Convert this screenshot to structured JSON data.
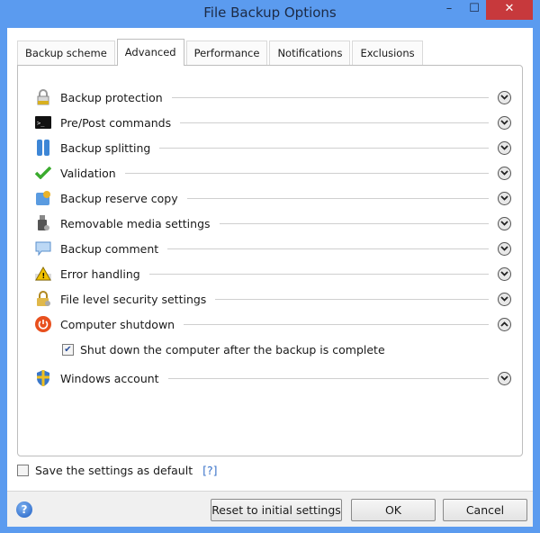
{
  "window": {
    "title": "File Backup Options",
    "minimize": "–",
    "maximize": "☐",
    "close": "✕"
  },
  "tabs": [
    {
      "label": "Backup scheme",
      "active": false
    },
    {
      "label": "Advanced",
      "active": true
    },
    {
      "label": "Performance",
      "active": false
    },
    {
      "label": "Notifications",
      "active": false
    },
    {
      "label": "Exclusions",
      "active": false
    }
  ],
  "sections": [
    {
      "label": "Backup protection",
      "icon": "lock-icon",
      "expanded": false
    },
    {
      "label": "Pre/Post commands",
      "icon": "terminal-icon",
      "expanded": false
    },
    {
      "label": "Backup splitting",
      "icon": "split-icon",
      "expanded": false
    },
    {
      "label": "Validation",
      "icon": "checkmark-icon",
      "expanded": false
    },
    {
      "label": "Backup reserve copy",
      "icon": "reserve-copy-icon",
      "expanded": false
    },
    {
      "label": "Removable media settings",
      "icon": "usb-drive-icon",
      "expanded": false
    },
    {
      "label": "Backup comment",
      "icon": "comment-icon",
      "expanded": false
    },
    {
      "label": "Error handling",
      "icon": "warning-icon",
      "expanded": false
    },
    {
      "label": "File level security settings",
      "icon": "security-lock-icon",
      "expanded": false
    },
    {
      "label": "Computer shutdown",
      "icon": "power-icon",
      "expanded": true
    },
    {
      "label": "Windows account",
      "icon": "shield-icon",
      "expanded": false
    }
  ],
  "shutdown_option": {
    "label": "Shut down the computer after the backup is complete",
    "checked": true
  },
  "save_default": {
    "label": "Save the settings as default",
    "checked": false,
    "help": "[?]"
  },
  "footer": {
    "help_icon": "?",
    "reset": "Reset to initial settings",
    "ok": "OK",
    "cancel": "Cancel"
  }
}
